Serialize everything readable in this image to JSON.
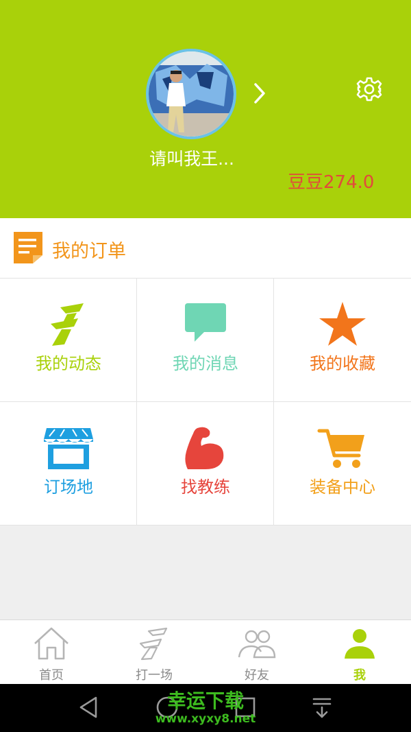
{
  "header": {
    "username": "请叫我王...",
    "beans": "豆豆274.0"
  },
  "orders": {
    "title": "我的订单"
  },
  "grid": {
    "items": [
      {
        "label": "我的动态",
        "icon": "running-icon",
        "color": "#a9d10a"
      },
      {
        "label": "我的消息",
        "icon": "message-icon",
        "color": "#6fd6b4"
      },
      {
        "label": "我的收藏",
        "icon": "star-icon",
        "color": "#f2751b"
      },
      {
        "label": "订场地",
        "icon": "store-icon",
        "color": "#1e9fe0"
      },
      {
        "label": "找教练",
        "icon": "muscle-icon",
        "color": "#e6453c"
      },
      {
        "label": "装备中心",
        "icon": "cart-icon",
        "color": "#f2a01b"
      }
    ]
  },
  "tabbar": {
    "tabs": [
      {
        "label": "首页",
        "icon": "home-icon"
      },
      {
        "label": "打一场",
        "icon": "running-icon"
      },
      {
        "label": "好友",
        "icon": "friends-icon"
      },
      {
        "label": "我",
        "icon": "person-icon",
        "active": true
      }
    ]
  },
  "watermark": {
    "title": "幸运下载",
    "url": "www.xyxy8.net"
  },
  "colors": {
    "header_bg": "#a9d10a",
    "accent_orange": "#f2951b",
    "beans_red": "#e24a3b"
  }
}
